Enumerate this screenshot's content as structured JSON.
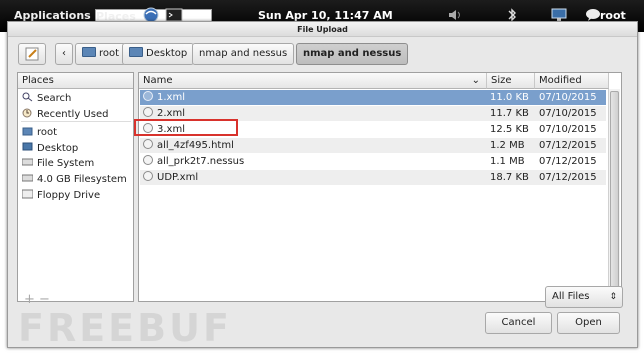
{
  "panel": {
    "applications": "Applications",
    "places": "Places",
    "clock": "Sun Apr 10, 11:47 AM",
    "user": "root",
    "icons": [
      "browser-icon",
      "terminal-icon",
      "volume-icon",
      "bluetooth-icon",
      "network-icon",
      "chat-icon"
    ]
  },
  "dialog": {
    "title": "File Upload",
    "path_buttons": [
      "root",
      "Desktop",
      "nmap and nessus",
      "nmap and nessus"
    ],
    "places_header": "Places",
    "places": [
      "Search",
      "Recently Used",
      "root",
      "Desktop",
      "File System",
      "4.0 GB Filesystem",
      "Floppy Drive"
    ],
    "columns": {
      "name": "Name",
      "size": "Size",
      "modified": "Modified"
    },
    "files": [
      {
        "name": "1.xml",
        "size": "11.0 KB",
        "modified": "07/10/2015"
      },
      {
        "name": "2.xml",
        "size": "11.7 KB",
        "modified": "07/10/2015"
      },
      {
        "name": "3.xml",
        "size": "12.5 KB",
        "modified": "07/10/2015"
      },
      {
        "name": "all_4zf495.html",
        "size": "1.2 MB",
        "modified": "07/12/2015"
      },
      {
        "name": "all_prk2t7.nessus",
        "size": "1.1 MB",
        "modified": "07/12/2015"
      },
      {
        "name": "UDP.xml",
        "size": "18.7 KB",
        "modified": "07/12/2015"
      }
    ],
    "filter": "All Files",
    "cancel": "Cancel",
    "open": "Open",
    "plus_minus": "+ −"
  },
  "watermark": "FREEBUF",
  "colors": {
    "selection": "#7a9fcc",
    "highlight_box": "#d8322c"
  }
}
